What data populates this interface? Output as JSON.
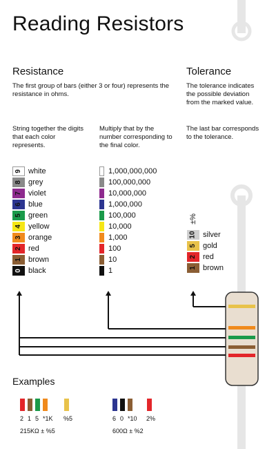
{
  "title": "Reading Resistors",
  "resistance": {
    "heading": "Resistance",
    "intro": "The first group of bars (either 3 or four) represents the resistance in ohms.",
    "digits_note": "String together the digits that each color represents.",
    "multiplier_note": "Multiply that by the number corresponding to the final color.",
    "digits": [
      {
        "digit": "9",
        "name": "white",
        "color": "#ffffff",
        "text": "#111111"
      },
      {
        "digit": "8",
        "name": "grey",
        "color": "#8a8a8a",
        "text": "#111111"
      },
      {
        "digit": "7",
        "name": "violet",
        "color": "#8e2a8e",
        "text": "#111111"
      },
      {
        "digit": "6",
        "name": "blue",
        "color": "#2c3590",
        "text": "#111111"
      },
      {
        "digit": "5",
        "name": "green",
        "color": "#1a9a4a",
        "text": "#111111"
      },
      {
        "digit": "4",
        "name": "yellow",
        "color": "#f5e616",
        "text": "#111111"
      },
      {
        "digit": "3",
        "name": "orange",
        "color": "#f08a1c",
        "text": "#111111"
      },
      {
        "digit": "2",
        "name": "red",
        "color": "#e3262a",
        "text": "#111111"
      },
      {
        "digit": "1",
        "name": "brown",
        "color": "#8b5e34",
        "text": "#111111"
      },
      {
        "digit": "0",
        "name": "black",
        "color": "#111111",
        "text": "#ffffff"
      }
    ],
    "multipliers": [
      {
        "value": "1,000,000,000",
        "color": "#ffffff"
      },
      {
        "value": "100,000,000",
        "color": "#8a8a8a"
      },
      {
        "value": "10,000,000",
        "color": "#8e2a8e"
      },
      {
        "value": "1,000,000",
        "color": "#2c3590"
      },
      {
        "value": "100,000",
        "color": "#1a9a4a"
      },
      {
        "value": "10,000",
        "color": "#f5e616"
      },
      {
        "value": "1,000",
        "color": "#f08a1c"
      },
      {
        "value": "100",
        "color": "#e3262a"
      },
      {
        "value": "10",
        "color": "#8b5e34"
      },
      {
        "value": "1",
        "color": "#111111"
      }
    ]
  },
  "tolerance": {
    "heading": "Tolerance",
    "intro": "The tolerance indicates the possible deviation from the marked value.",
    "note": "The last bar corresponds to the tolerance.",
    "symbol": "±%",
    "items": [
      {
        "digit": "10",
        "name": "silver",
        "color": "#cfcfcf"
      },
      {
        "digit": "5",
        "name": "gold",
        "color": "#e8c24a"
      },
      {
        "digit": "2",
        "name": "red",
        "color": "#e3262a"
      },
      {
        "digit": "1",
        "name": "brown",
        "color": "#8b5e34"
      }
    ]
  },
  "resistor": {
    "body_color": "#e9ded0",
    "lead_color": "#e6e6e6",
    "bands": [
      "#e8c24a",
      "#f08a1c",
      "#1a9a4a",
      "#8b5e34",
      "#e3262a"
    ]
  },
  "examples": {
    "heading": "Examples",
    "items": [
      {
        "bands": [
          "#e3262a",
          "#8b5e34",
          "#1a9a4a",
          "#f08a1c"
        ],
        "tol_color": "#e8c24a",
        "band_labels": [
          "2",
          "1",
          "5",
          "*1K"
        ],
        "tol_label": "%5",
        "result": "215KΩ ± %5"
      },
      {
        "bands": [
          "#2c3590",
          "#111111",
          "#8b5e34"
        ],
        "tol_color": "#e3262a",
        "band_labels": [
          "6",
          "0",
          "*10"
        ],
        "tol_label": "2%",
        "result": "600Ω ± %2"
      }
    ]
  }
}
